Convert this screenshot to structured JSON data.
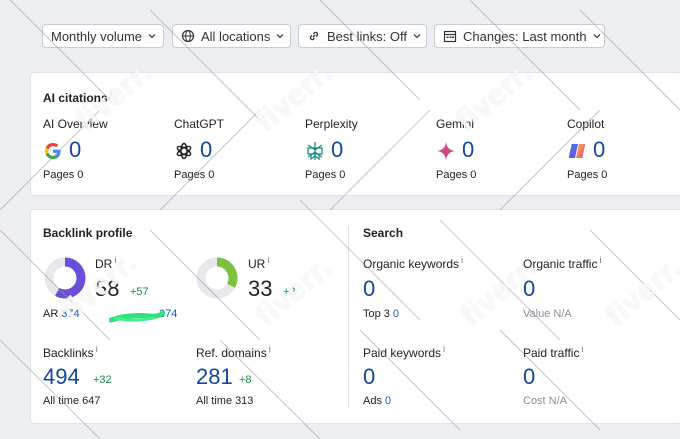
{
  "toolbar": {
    "monthly_volume": "Monthly volume",
    "all_locations": "All locations",
    "best_links": "Best links: Off",
    "changes": "Changes: Last month"
  },
  "ai_citations": {
    "title": "AI citations",
    "info": "i",
    "items": [
      {
        "name": "AI Overview",
        "value": "0",
        "pages_label": "Pages",
        "pages": "0",
        "icon": "google-g-icon"
      },
      {
        "name": "ChatGPT",
        "value": "0",
        "pages_label": "Pages",
        "pages": "0",
        "icon": "chatgpt-icon"
      },
      {
        "name": "Perplexity",
        "value": "0",
        "pages_label": "Pages",
        "pages": "0",
        "icon": "perplexity-icon"
      },
      {
        "name": "Gemini",
        "value": "0",
        "pages_label": "Pages",
        "pages": "0",
        "icon": "gemini-icon"
      },
      {
        "name": "Copilot",
        "value": "0",
        "pages_label": "Pages",
        "pages": "0",
        "icon": "copilot-icon"
      }
    ]
  },
  "backlink_profile": {
    "title": "Backlink profile",
    "dr": {
      "label": "DR",
      "info": "i",
      "value": "58",
      "delta": "+57",
      "fill": 0.58,
      "color": "#6b4fd8"
    },
    "ur": {
      "label": "UR",
      "info": "i",
      "value": "33",
      "delta": "+2",
      "fill": 0.33,
      "color": "#7cc242"
    },
    "ar": {
      "label": "AR",
      "value": "374",
      "tail": "374"
    },
    "backlinks": {
      "label": "Backlinks",
      "info": "i",
      "value": "494",
      "delta": "+32",
      "sub_label": "All time",
      "sub_value": "647"
    },
    "ref_domains": {
      "label": "Ref. domains",
      "info": "i",
      "value": "281",
      "delta": "+8",
      "sub_label": "All time",
      "sub_value": "313"
    }
  },
  "search": {
    "title": "Search",
    "organic_keywords": {
      "label": "Organic keywords",
      "info": "i",
      "value": "0",
      "sub_label": "Top 3",
      "sub_value": "0"
    },
    "organic_traffic": {
      "label": "Organic traffic",
      "info": "i",
      "value": "0",
      "sub_label": "Value",
      "sub_value": "N/A"
    },
    "paid_keywords": {
      "label": "Paid keywords",
      "info": "i",
      "value": "0",
      "sub_label": "Ads",
      "sub_value": "0"
    },
    "paid_traffic": {
      "label": "Paid traffic",
      "info": "i",
      "value": "0",
      "sub_label": "Cost",
      "sub_value": "N/A"
    }
  },
  "watermark": "fiverr."
}
